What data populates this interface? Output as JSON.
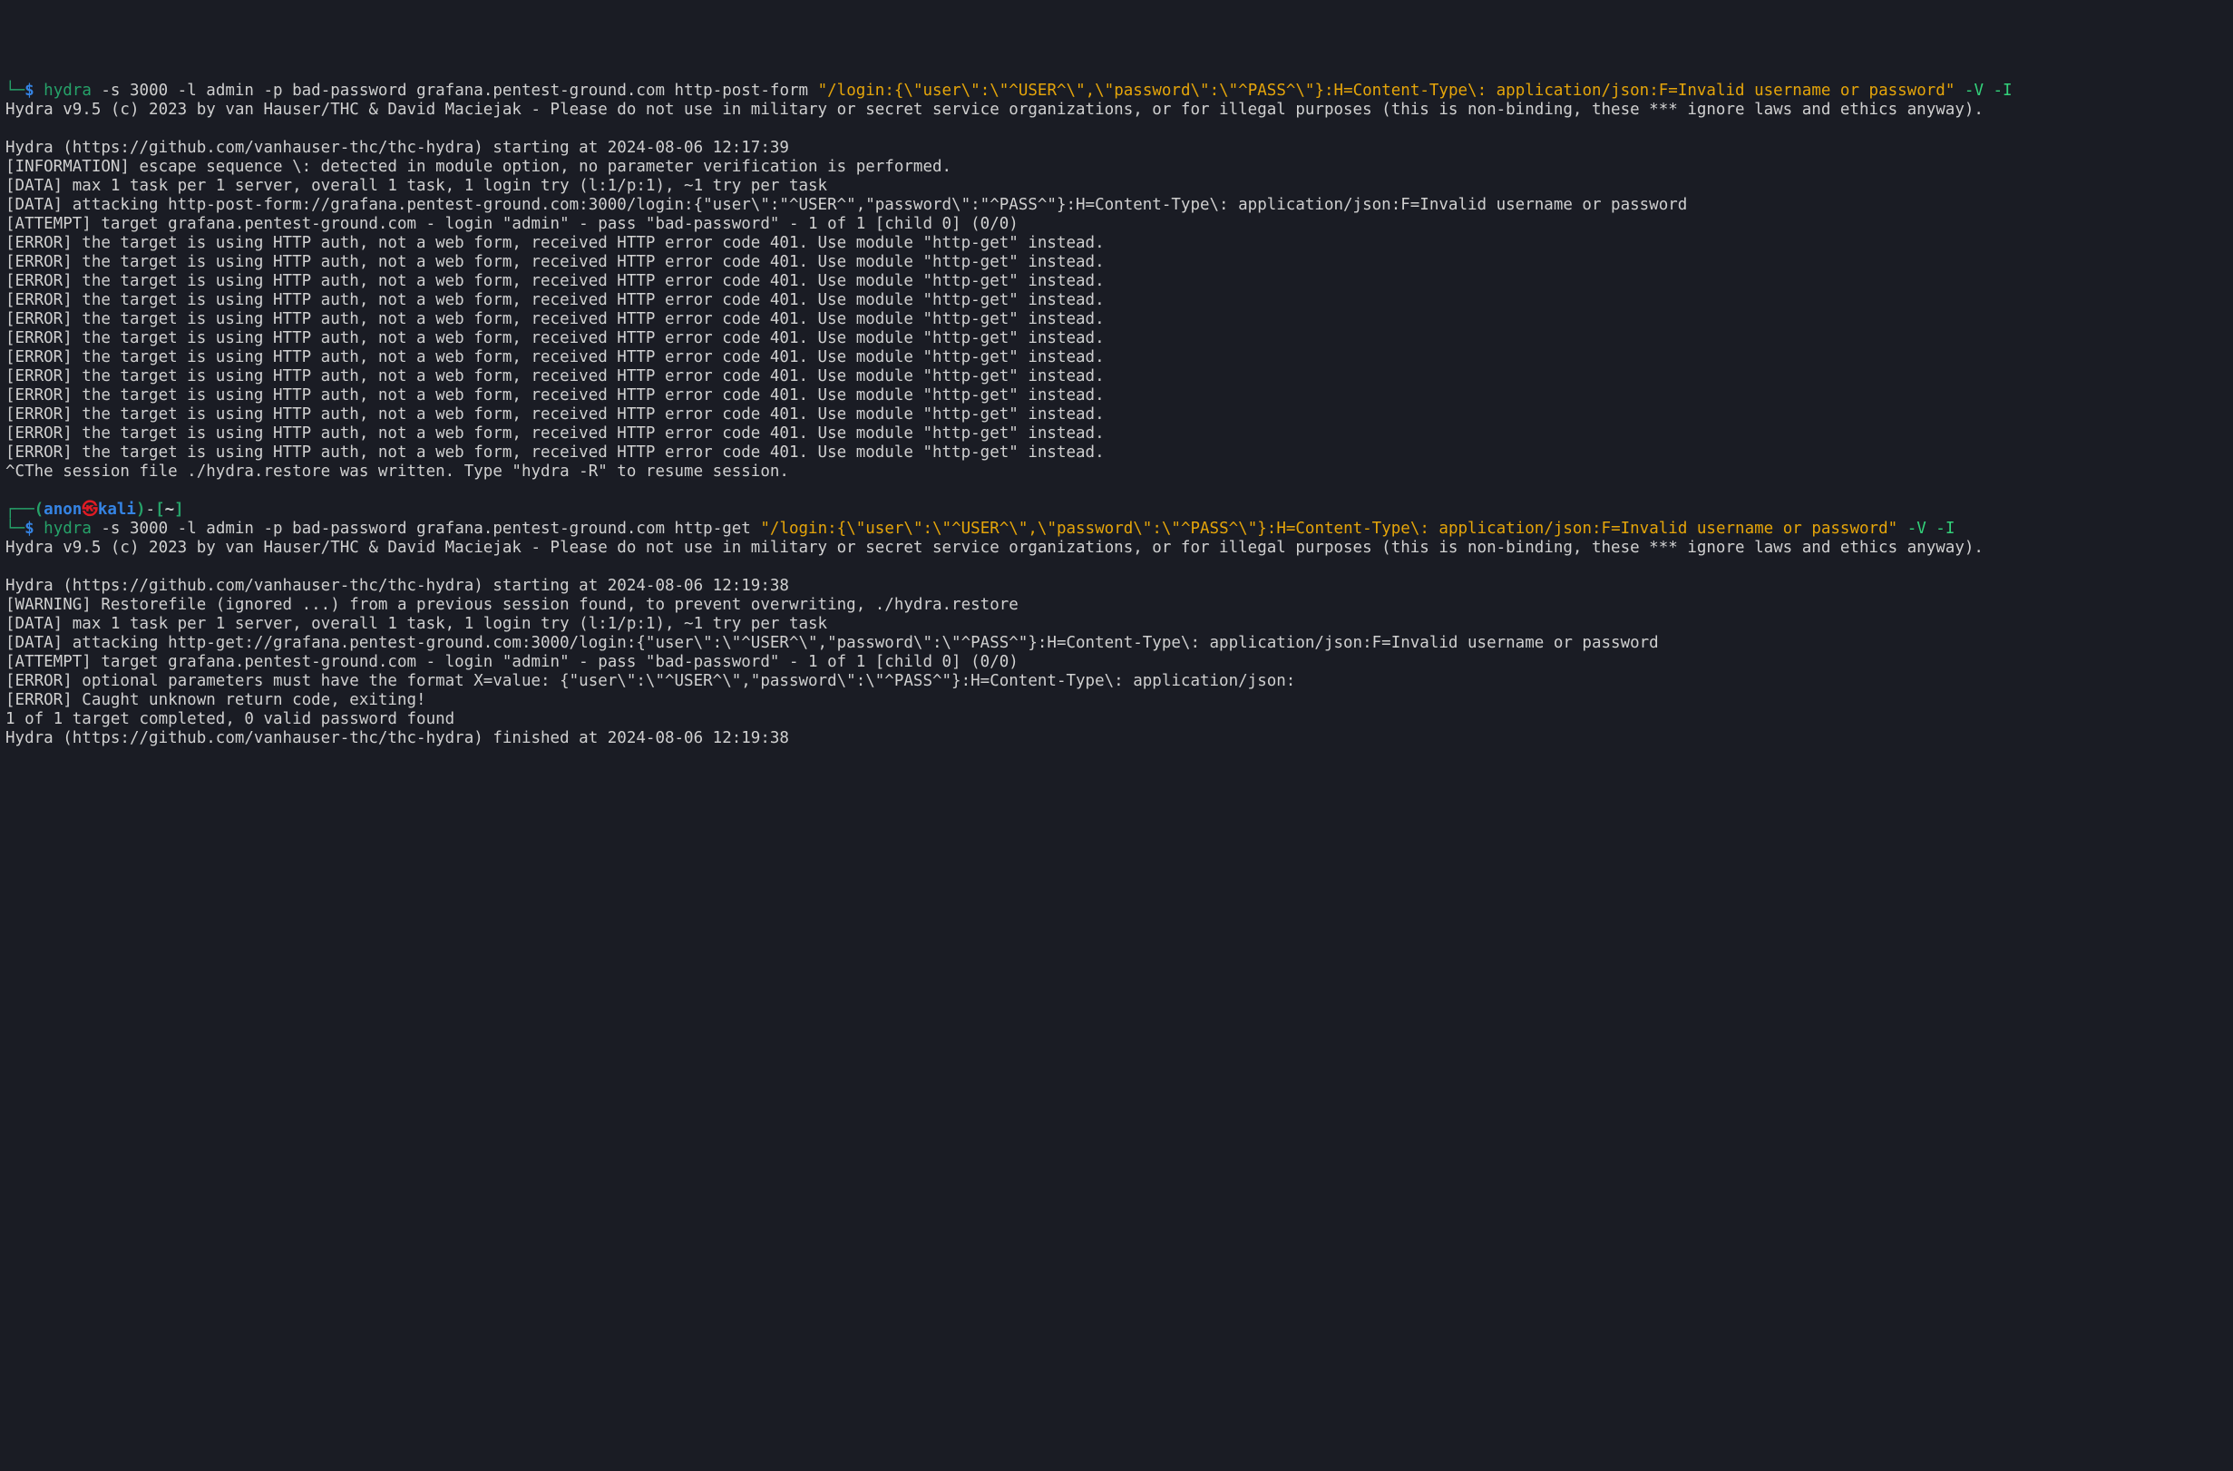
{
  "session1": {
    "prompt": {
      "corner": "└─",
      "dollar": "$",
      "cmdname": "hydra",
      "args1": " -s 3000 -l admin -p bad-password grafana.pentest-ground.com http-post-form ",
      "payload": "\"/login:{\\\"user\\\":\\\"^USER^\\\",\\\"password\\\":\\\"^PASS^\\\"}:H=Content-Type\\: application/json:F=Invalid username or password\"",
      "flags": " -V -I"
    },
    "banner": "Hydra v9.5 (c) 2023 by van Hauser/THC & David Maciejak - Please do not use in military or secret service organizations, or for illegal purposes (this is non-binding, these *** ignore laws and ethics anyway).",
    "starting": "Hydra (https://github.com/vanhauser-thc/thc-hydra) starting at 2024-08-06 12:17:39",
    "info": "[INFORMATION] escape sequence \\: detected in module option, no parameter verification is performed.",
    "data1": "[DATA] max 1 task per 1 server, overall 1 task, 1 login try (l:1/p:1), ~1 try per task",
    "data2": "[DATA] attacking http-post-form://grafana.pentest-ground.com:3000/login:{\"user\\\":\"^USER^\",\"password\\\":\"^PASS^\"}:H=Content-Type\\: application/json:F=Invalid username or password",
    "attempt": "[ATTEMPT] target grafana.pentest-ground.com - login \"admin\" - pass \"bad-password\" - 1 of 1 [child 0] (0/0)",
    "err1": "[ERROR] the target is using HTTP auth, not a web form, received HTTP error code 401. Use module \"http-get\" instead.",
    "err2": "[ERROR] the target is using HTTP auth, not a web form, received HTTP error code 401. Use module \"http-get\" instead.",
    "err3": "[ERROR] the target is using HTTP auth, not a web form, received HTTP error code 401. Use module \"http-get\" instead.",
    "err4": "[ERROR] the target is using HTTP auth, not a web form, received HTTP error code 401. Use module \"http-get\" instead.",
    "err5": "[ERROR] the target is using HTTP auth, not a web form, received HTTP error code 401. Use module \"http-get\" instead.",
    "err6": "[ERROR] the target is using HTTP auth, not a web form, received HTTP error code 401. Use module \"http-get\" instead.",
    "err7": "[ERROR] the target is using HTTP auth, not a web form, received HTTP error code 401. Use module \"http-get\" instead.",
    "err8": "[ERROR] the target is using HTTP auth, not a web form, received HTTP error code 401. Use module \"http-get\" instead.",
    "err9": "[ERROR] the target is using HTTP auth, not a web form, received HTTP error code 401. Use module \"http-get\" instead.",
    "err10": "[ERROR] the target is using HTTP auth, not a web form, received HTTP error code 401. Use module \"http-get\" instead.",
    "err11": "[ERROR] the target is using HTTP auth, not a web form, received HTTP error code 401. Use module \"http-get\" instead.",
    "err12": "[ERROR] the target is using HTTP auth, not a web form, received HTTP error code 401. Use module \"http-get\" instead.",
    "restore": "^CThe session file ./hydra.restore was written. Type \"hydra -R\" to resume session."
  },
  "prompt2": {
    "corner_top": "┌──",
    "paren_open": "(",
    "user": "anon",
    "skull": "㉿",
    "host": "kali",
    "paren_close": ")",
    "dash": "-",
    "bracket_open": "[",
    "tilde": "~",
    "bracket_close": "]"
  },
  "session2": {
    "prompt": {
      "corner": "└─",
      "dollar": "$",
      "cmdname": "hydra",
      "args1": " -s 3000 -l admin -p bad-password grafana.pentest-ground.com http-get ",
      "payload": "\"/login:{\\\"user\\\":\\\"^USER^\\\",\\\"password\\\":\\\"^PASS^\\\"}:H=Content-Type\\: application/json:F=Invalid username or password\"",
      "flags": " -V -I"
    },
    "banner": "Hydra v9.5 (c) 2023 by van Hauser/THC & David Maciejak - Please do not use in military or secret service organizations, or for illegal purposes (this is non-binding, these *** ignore laws and ethics anyway).",
    "starting": "Hydra (https://github.com/vanhauser-thc/thc-hydra) starting at 2024-08-06 12:19:38",
    "warning": "[WARNING] Restorefile (ignored ...) from a previous session found, to prevent overwriting, ./hydra.restore",
    "data1": "[DATA] max 1 task per 1 server, overall 1 task, 1 login try (l:1/p:1), ~1 try per task",
    "data2": "[DATA] attacking http-get://grafana.pentest-ground.com:3000/login:{\"user\\\":\\\"^USER^\\\",\"password\\\":\\\"^PASS^\"}:H=Content-Type\\: application/json:F=Invalid username or password",
    "attempt": "[ATTEMPT] target grafana.pentest-ground.com - login \"admin\" - pass \"bad-password\" - 1 of 1 [child 0] (0/0)",
    "err1": "[ERROR] optional parameters must have the format X=value: {\"user\\\":\\\"^USER^\\\",\"password\\\":\\\"^PASS^\"}:H=Content-Type\\: application/json:",
    "err2": "[ERROR] Caught unknown return code, exiting!",
    "result": "1 of 1 target completed, 0 valid password found",
    "finished": "Hydra (https://github.com/vanhauser-thc/thc-hydra) finished at 2024-08-06 12:19:38"
  }
}
